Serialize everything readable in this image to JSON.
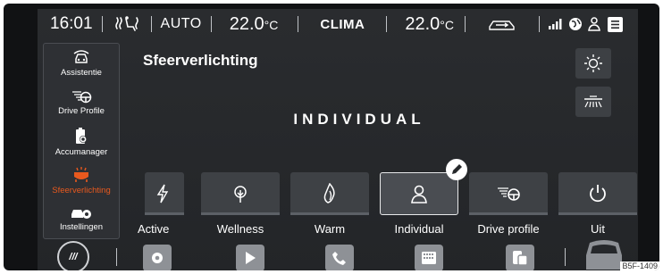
{
  "status_bar": {
    "time": "16:01",
    "auto": "AUTO",
    "temp_left": "22.0",
    "temp_left_unit": "°C",
    "clima": "CLIMA",
    "temp_right": "22.0",
    "temp_right_unit": "°C"
  },
  "sidebar": {
    "items": [
      {
        "label": "Assistentie",
        "icon": "car-assist-icon"
      },
      {
        "label": "Drive Profile",
        "icon": "drive-profile-icon"
      },
      {
        "label": "Accumanager",
        "icon": "battery-gear-icon"
      },
      {
        "label": "Sfeerverlichting",
        "icon": "ambient-light-icon",
        "active": true
      },
      {
        "label": "Instellingen",
        "icon": "car-settings-icon"
      }
    ]
  },
  "main": {
    "title": "Sfeerverlichting",
    "mode": "INDIVIDUAL",
    "quick_buttons": [
      "brightness-icon",
      "footwell-light-icon"
    ],
    "cards": [
      {
        "label": "Active",
        "icon": "bolt-icon"
      },
      {
        "label": "Wellness",
        "icon": "leaf-icon"
      },
      {
        "label": "Warm",
        "icon": "flame-icon"
      },
      {
        "label": "Individual",
        "icon": "person-icon",
        "selected": true
      },
      {
        "label": "Drive profile",
        "icon": "drive-profile-icon"
      },
      {
        "label": "Uit",
        "icon": "power-icon"
      }
    ]
  },
  "dock": {
    "home_label": "///",
    "buttons": [
      "settings-icon",
      "play-icon",
      "phone-icon",
      "app-grid-icon",
      "phone-projection-icon",
      "car-icon"
    ]
  },
  "colors": {
    "accent": "#e8591e",
    "background": "#26282b",
    "card": "#3e4145"
  },
  "reference_code": "B5F-1409"
}
